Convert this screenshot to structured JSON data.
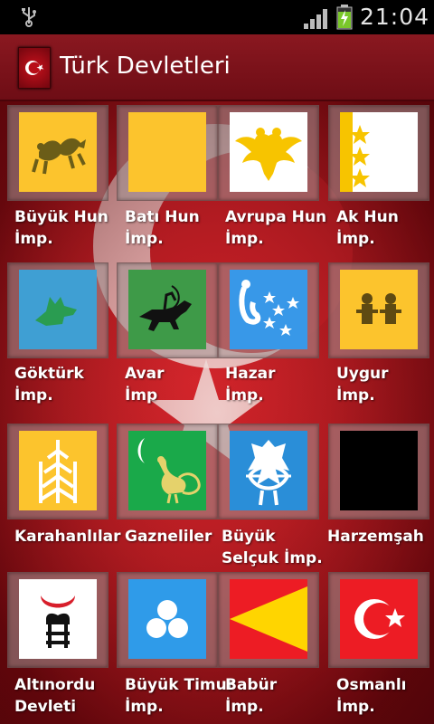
{
  "status_bar": {
    "time": "21:04",
    "icons": [
      "usb-icon",
      "signal-icon",
      "battery-charging-icon"
    ]
  },
  "action_bar": {
    "title": "Türk Devletleri",
    "icon": "turkish-flag-app-icon"
  },
  "states": [
    {
      "name": "Büyük Hun\nİmp.",
      "flag": "yellow-dragon"
    },
    {
      "name": "Batı Hun\nİmp.",
      "flag": "plain-yellow"
    },
    {
      "name": "Avrupa Hun\nİmp.",
      "flag": "double-headed-eagle"
    },
    {
      "name": "Ak Hun\nİmp.",
      "flag": "three-stars"
    },
    {
      "name": "Göktürk\nİmp.",
      "flag": "wolf-head"
    },
    {
      "name": "Avar\nİmp",
      "flag": "horse-archer"
    },
    {
      "name": "Hazar\nİmp.",
      "flag": "blue-tamga-stars"
    },
    {
      "name": "Uygur\nİmp.",
      "flag": "yellow-deities"
    },
    {
      "name": "Karahanlılar",
      "flag": "yellow-tree-tamga"
    },
    {
      "name": "Gazneliler",
      "flag": "green-peacock-crescent"
    },
    {
      "name": "Büyük\nSelçuk İmp.",
      "flag": "blue-eagle-bow"
    },
    {
      "name": "Harzemşah",
      "flag": "plain-black"
    },
    {
      "name": "Altınordu\nDevleti",
      "flag": "white-golden-horde"
    },
    {
      "name": "Büyük Timur\nİmp.",
      "flag": "blue-three-circles"
    },
    {
      "name": "Babür\nİmp.",
      "flag": "red-yellow-triangle"
    },
    {
      "name": "Osmanlı\nİmp.",
      "flag": "red-crescent-star"
    }
  ],
  "colors": {
    "action_bar": "#7d121a",
    "background_red": "#c41e25"
  }
}
